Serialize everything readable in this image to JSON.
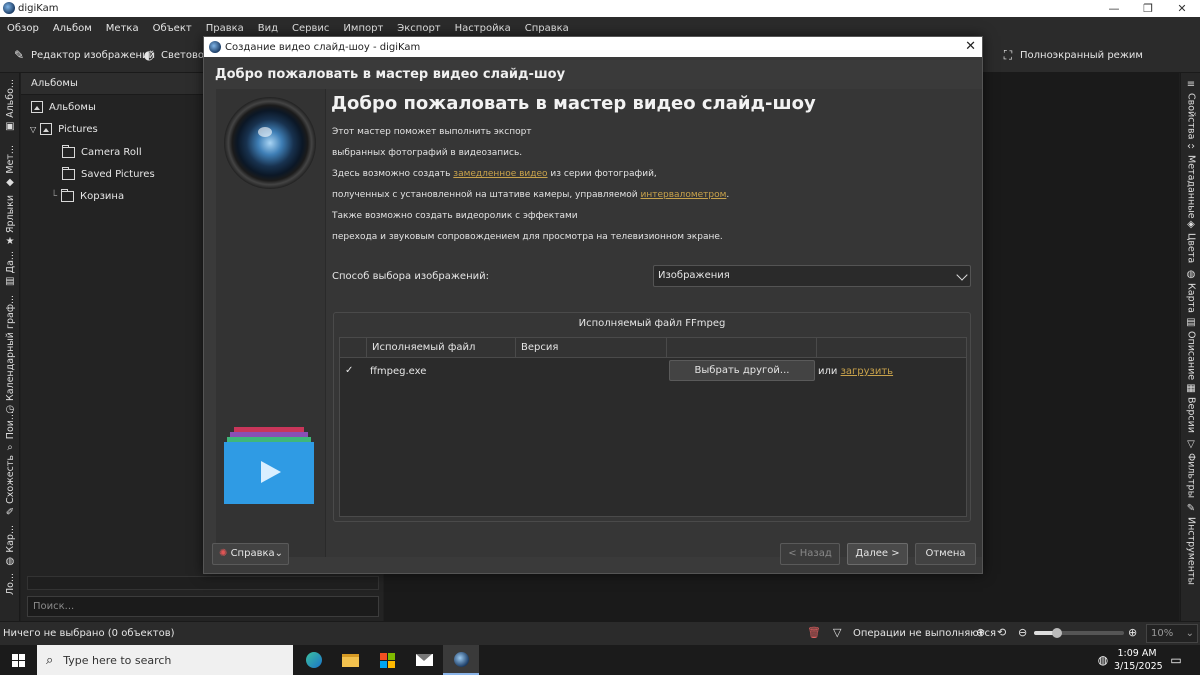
{
  "window": {
    "title": "digiKam"
  },
  "menu": [
    "Обзор",
    "Альбом",
    "Метка",
    "Объект",
    "Правка",
    "Вид",
    "Сервис",
    "Импорт",
    "Экспорт",
    "Настройка",
    "Справка"
  ],
  "toolbar": {
    "editor": "Редактор изображений",
    "light": "Световой",
    "fullscreen": "Полноэкранный режим"
  },
  "left_tabs": [
    "Альбо...",
    "Мет...",
    "Ярлыки",
    "Да...",
    "Календарный граф...",
    "Пои...",
    "Схожесть",
    "Кар...",
    "Ло..."
  ],
  "right_tabs": [
    "Свойства",
    "Метаданные",
    "Цвета",
    "Карта",
    "Описание",
    "Версии",
    "Фильтры",
    "Инструменты"
  ],
  "albums": {
    "header": "Альбомы",
    "root": "Альбомы",
    "pictures": "Pictures",
    "items": [
      "Camera Roll",
      "Saved Pictures",
      "Корзина"
    ],
    "search_placeholder": "Поиск..."
  },
  "status": {
    "selection": "Ничего не выбрано (0 объектов)",
    "ops": "Операции не выполняются",
    "zoom": "10%",
    "zoom_fraction": 0.25
  },
  "dialog": {
    "title": "Создание видео слайд-шоу - digiKam",
    "header": "Добро пожаловать в мастер видео слайд-шоу",
    "big_title": "Добро пожаловать в мастер видео слайд-шоу",
    "p1": "Этот мастер поможет выполнить экспорт",
    "p2": "выбранных фотографий в видеозапись.",
    "p3_pre": "Здесь возможно создать ",
    "p3_link": "замедленное видео",
    "p3_post": " из серии фотографий,",
    "p4_pre": "полученных с установленной на штативе камеры, управляемой ",
    "p4_link": "интервалометром",
    "p4_post": ".",
    "p5": "Также возможно создать видеоролик с эффектами",
    "p6": "перехода и звуковым сопровождением для просмотра на телевизионном экране.",
    "method_label": "Способ выбора изображений:",
    "method_value": "Изображения",
    "ffmpeg_title": "Исполняемый файл FFmpeg",
    "col_file": "Исполняемый файл",
    "col_version": "Версия",
    "row_file": "ffmpeg.exe",
    "row_check": "✓",
    "pick_other": "Выбрать другой...",
    "or": "или",
    "download": "загрузить",
    "help": "Справка",
    "back": "< Назад",
    "next": "Далее >",
    "cancel": "Отмена"
  },
  "taskbar": {
    "search": "Type here to search",
    "time": "1:09 AM",
    "date": "3/15/2025"
  }
}
